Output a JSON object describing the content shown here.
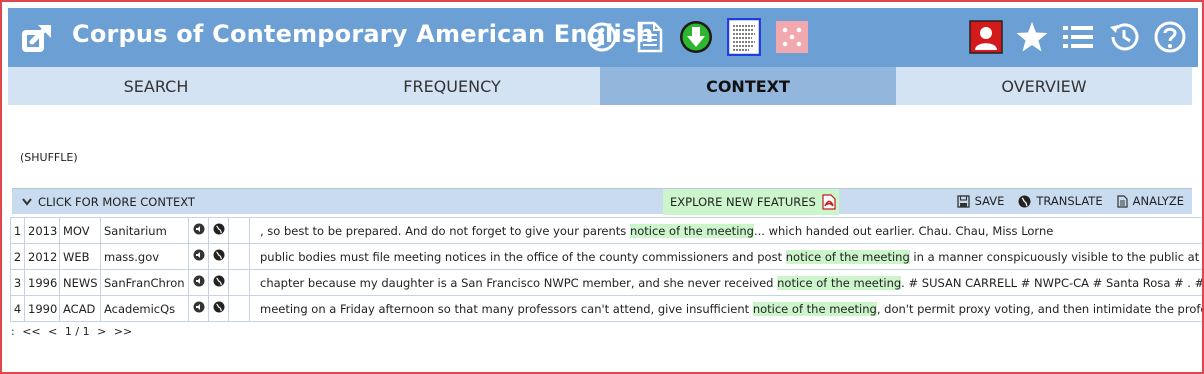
{
  "header": {
    "title": "Corpus of Contemporary American English",
    "icons": [
      "external-link-icon",
      "info-icon",
      "document-icon",
      "download-icon",
      "text-sample-icon",
      "random-dice-icon",
      "user-profile-icon",
      "star-icon",
      "list-icon",
      "history-icon",
      "help-icon"
    ]
  },
  "tabs": [
    {
      "label": "SEARCH",
      "active": false
    },
    {
      "label": "FREQUENCY",
      "active": false
    },
    {
      "label": "CONTEXT",
      "active": true
    },
    {
      "label": "OVERVIEW",
      "active": false
    }
  ],
  "shuffle": "(SHUFFLE)",
  "toolbar": {
    "more_context": "CLICK FOR MORE CONTEXT",
    "explore": "EXPLORE NEW FEATURES",
    "save": "SAVE",
    "translate": "TRANSLATE",
    "analyze": "ANALYZE"
  },
  "rows": [
    {
      "num": "1",
      "year": "2013",
      "genre": "MOV",
      "source": "Sanitarium",
      "before": ", so best to be prepared. And do not forget to give your parents ",
      "kw": [
        "notice",
        "of",
        "the",
        "meeting"
      ],
      "after": "... which handed out earlier. Chau. Chau, Miss Lorne"
    },
    {
      "num": "2",
      "year": "2012",
      "genre": "WEB",
      "source": "mass.gov",
      "before": "public bodies must file meeting notices in the office of the county commissioners and post ",
      "kw": [
        "notice",
        "of",
        "the",
        "meeting"
      ],
      "after": " in a manner conspicuously visible to the public at all hours"
    },
    {
      "num": "3",
      "year": "1996",
      "genre": "NEWS",
      "source": "SanFranChron",
      "before": "chapter because my daughter is a San Francisco NWPC member, and she never received ",
      "kw": [
        "notice",
        "of",
        "the",
        "meeting"
      ],
      "after": ". # SUSAN CARRELL # NWPC-CA # Santa Rosa # . #"
    },
    {
      "num": "4",
      "year": "1990",
      "genre": "ACAD",
      "source": "AcademicQs",
      "before": "meeting on a Friday afternoon so that many professors can't attend, give insufficient ",
      "kw": [
        "notice",
        "of",
        "the",
        "meeting"
      ],
      "after": ", don't permit proxy voting, and then intimidate the professors"
    }
  ],
  "pager": {
    "prefix": ":",
    "first": "<<",
    "prev": "<",
    "page": "1 / 1",
    "next": ">",
    "last": ">>"
  },
  "colors": {
    "header_bg": "#6c9fd3",
    "tab_bg": "#d4e3f4",
    "tab_active_bg": "#93b6dc",
    "highlight": "#ccf5cc",
    "frame_border": "#e0474c"
  }
}
